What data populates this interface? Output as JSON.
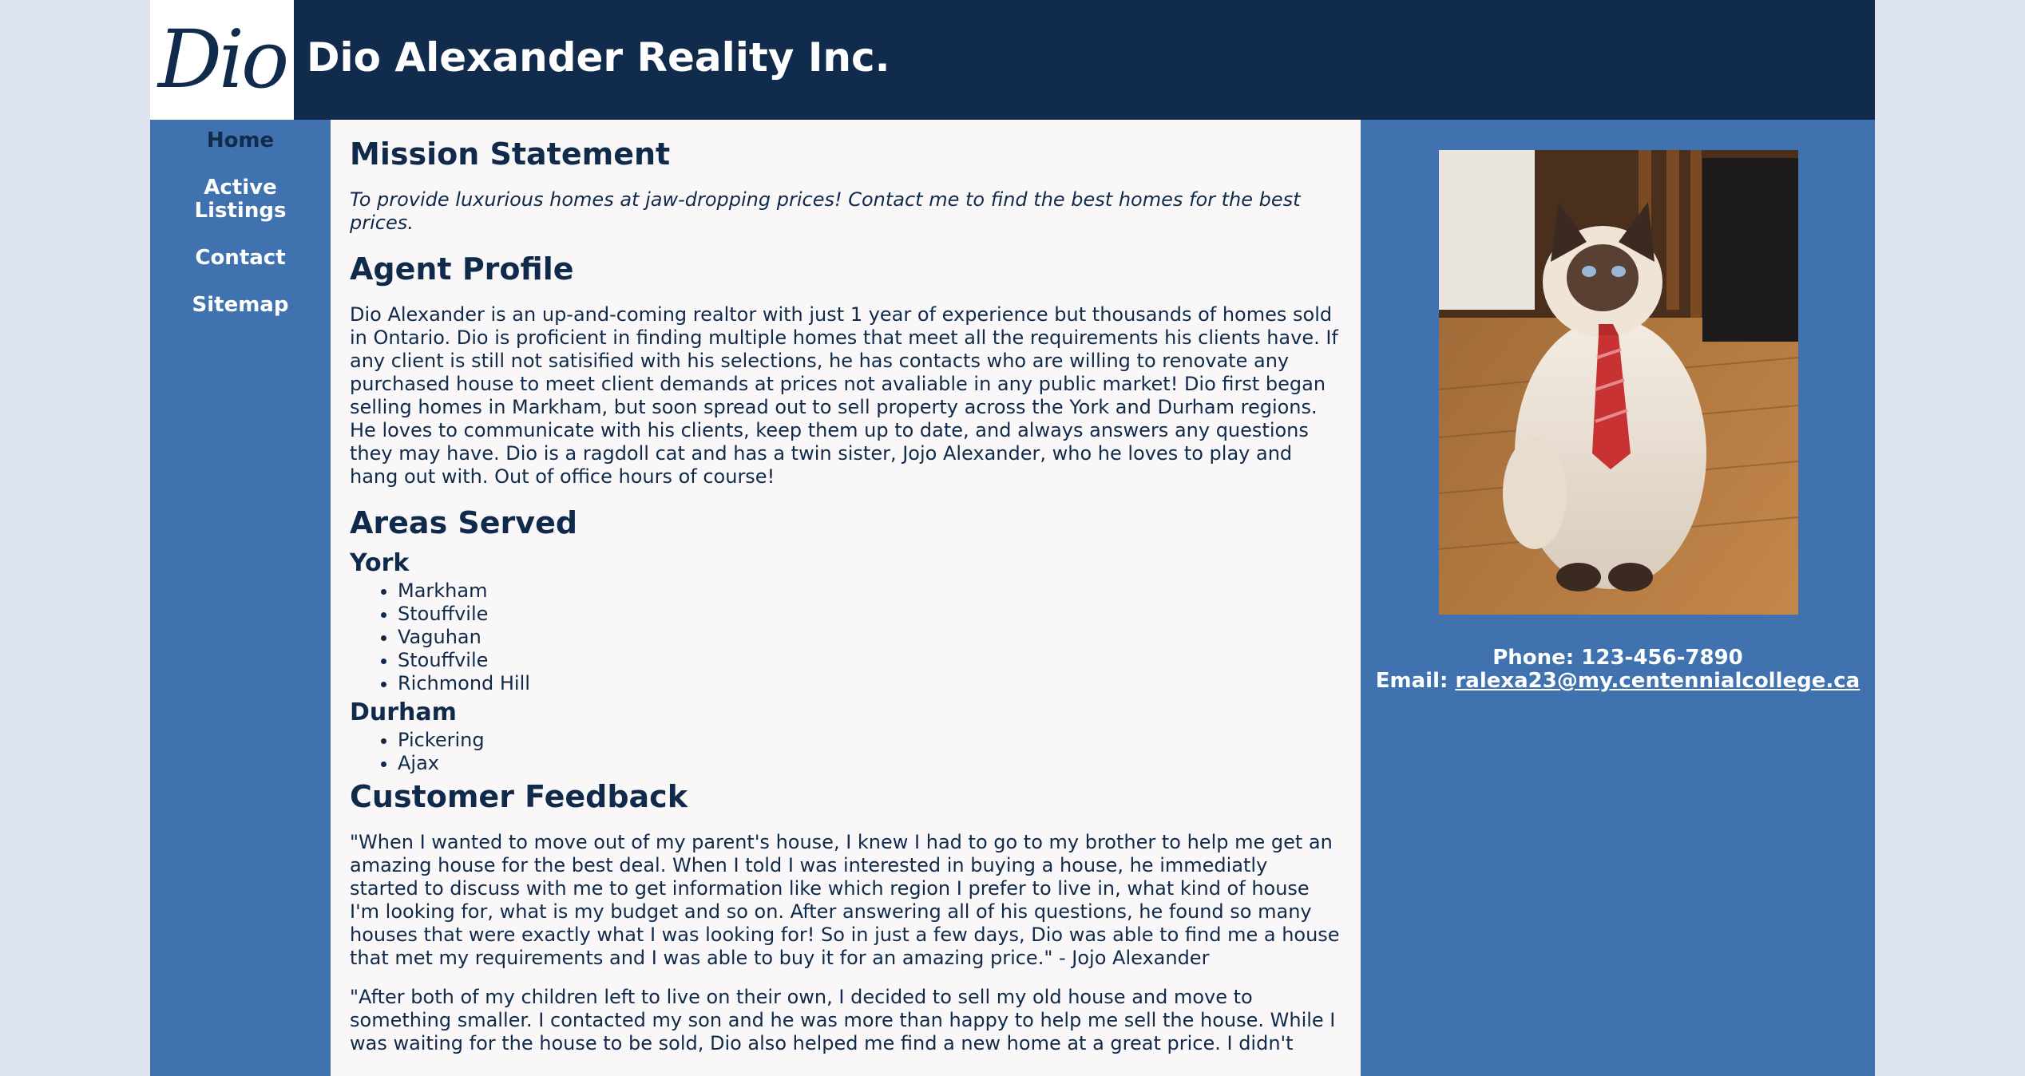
{
  "header": {
    "logo_text": "Dio",
    "title": "Dio Alexander Reality Inc."
  },
  "nav": {
    "items": [
      {
        "label": "Home",
        "active": true
      },
      {
        "label": "Active Listings",
        "active": false
      },
      {
        "label": "Contact",
        "active": false
      },
      {
        "label": "Sitemap",
        "active": false
      }
    ]
  },
  "main": {
    "mission": {
      "heading": "Mission Statement",
      "text": "To provide luxurious homes at jaw-dropping prices! Contact me to find the best homes for the best prices."
    },
    "profile": {
      "heading": "Agent Profile",
      "text": "Dio Alexander is an up-and-coming realtor with just 1 year of experience but thousands of homes sold in Ontario. Dio is proficient in finding multiple homes that meet all the requirements his clients have. If any client is still not satisified with his selections, he has contacts who are willing to renovate any purchased house to meet client demands at prices not avaliable in any public market! Dio first began selling homes in Markham, but soon spread out to sell property across the York and Durham regions. He loves to communicate with his clients, keep them up to date, and always answers any questions they may have. Dio is a ragdoll cat and has a twin sister, Jojo Alexander, who he loves to play and hang out with. Out of office hours of course!"
    },
    "areas": {
      "heading": "Areas Served",
      "york": {
        "heading": "York",
        "items": [
          "Markham",
          "Stouffvile",
          "Vaguhan",
          "Stouffvile",
          "Richmond Hill"
        ]
      },
      "durham": {
        "heading": "Durham",
        "items": [
          "Pickering",
          "Ajax"
        ]
      }
    },
    "feedback": {
      "heading": "Customer Feedback",
      "quote1": "\"When I wanted to move out of my parent's house, I knew I had to go to my brother to help me get an amazing house for the best deal. When I told I was interested in buying a house, he immediatly started to discuss with me to get information like which region I prefer to live in, what kind of house I'm looking for, what is my budget and so on. After answering all of his questions, he found so many houses that were exactly what I was looking for! So in just a few days, Dio was able to find me a house that met my requirements and I was able to buy it for an amazing price.\" - Jojo Alexander",
      "quote2": "\"After both of my children left to live on their own, I decided to sell my old house and move to something smaller. I contacted my son and he was more than happy to help me sell the house. While I was waiting for the house to be sold, Dio also helped me find a new home at a great price. I didn't"
    }
  },
  "aside": {
    "photo_alt": "Ragdoll cat wearing a red tie",
    "phone_label": "Phone:",
    "phone": "123-456-7890",
    "email_label": "Email:",
    "email": "ralexa23@my.centennialcollege.ca"
  },
  "colors": {
    "header_bg": "#112b4d",
    "sidebar_bg": "#3f72af",
    "content_bg": "#faf7f8",
    "page_bg": "#dde3ef"
  }
}
